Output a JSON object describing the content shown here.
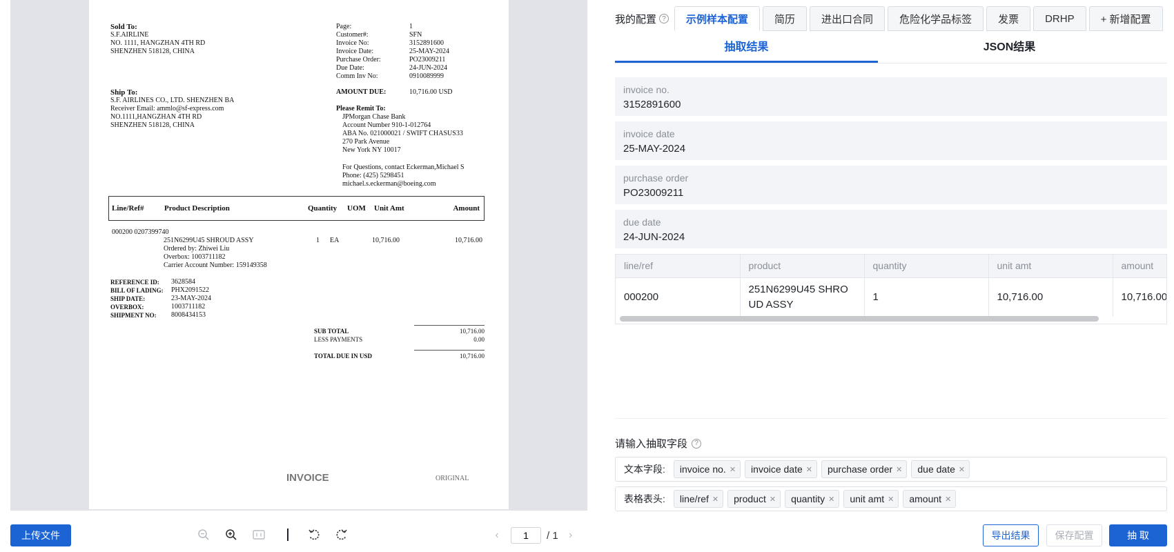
{
  "document": {
    "sold_to": {
      "title": "Sold To:",
      "lines": [
        "S.F.AIRLINE",
        "NO. 1111, HANGZHAN 4TH RD",
        "SHENZHEN  518128, CHINA"
      ]
    },
    "ship_to": {
      "title": "Ship To:",
      "lines": [
        "S.F. AIRLINES CO., LTD. SHENZHEN BA",
        "Receiver Email: ammlo@sf-express.com",
        "NO.1111,HANGZHAN 4TH RD",
        "SHENZHEN   518128, CHINA"
      ]
    },
    "meta": [
      {
        "k": "Page:",
        "v": "1"
      },
      {
        "k": "Customer#:",
        "v": "SFN"
      },
      {
        "k": "Invoice No:",
        "v": "3152891600"
      },
      {
        "k": "Invoice Date:",
        "v": "25-MAY-2024"
      },
      {
        "k": "Purchase Order:",
        "v": "PO23009211"
      },
      {
        "k": "Due Date:",
        "v": "24-JUN-2024"
      },
      {
        "k": "Comm Inv No:",
        "v": "0910089999"
      }
    ],
    "amount_due_label": "AMOUNT DUE:",
    "amount_due_value": "10,716.00  USD",
    "remit_title": "Please Remit To:",
    "remit_lines": [
      "JPMorgan Chase Bank",
      "Account Number 910-1-012764",
      "ABA No. 021000021 / SWIFT CHASUS33",
      "270 Park Avenue",
      "New York NY 10017"
    ],
    "contact_lines": [
      "For Questions, contact  Eckerman,Michael S",
      "Phone:  (425) 5298451",
      "michael.s.eckerman@boeing.com"
    ],
    "table_headers": {
      "line": "Line/Ref#",
      "desc": "Product Description",
      "qty": "Quantity",
      "uom": "UOM",
      "unit": "Unit Amt",
      "amount": "Amount"
    },
    "line_ref": "000200 0207399740",
    "item_desc": [
      "251N6299U45  SHROUD ASSY",
      "Ordered by:  Zhiwei Liu",
      "Overbox: 1003711182",
      "Carrier Account Number: 159149358"
    ],
    "item_qty": "1",
    "item_uom": "EA",
    "item_unit": "10,716.00",
    "item_amount": "10,716.00",
    "refs": [
      {
        "k": "REFERENCE ID:",
        "v": "3628584"
      },
      {
        "k": "BILL OF LADING:",
        "v": "PHX2091522"
      },
      {
        "k": "SHIP DATE:",
        "v": "23-MAY-2024"
      },
      {
        "k": "OVERBOX:",
        "v": "1003711182"
      },
      {
        "k": "SHIPMENT NO:",
        "v": "8008434153"
      }
    ],
    "subtotal_label": "SUB TOTAL",
    "subtotal_value": "10,716.00",
    "payments_label": "LESS PAYMENTS",
    "payments_value": "0.00",
    "total_label": "TOTAL DUE IN USD",
    "total_value": "10,716.00",
    "footer_left": "INVOICE",
    "footer_right": "ORIGINAL"
  },
  "viewer": {
    "upload_label": "上传文件",
    "page_current": "1",
    "page_total": "/ 1"
  },
  "panel": {
    "config_title": "我的配置",
    "config_tabs": [
      "示例样本配置",
      "简历",
      "进出口合同",
      "危险化学品标签",
      "发票",
      "DRHP",
      "+ 新增配置"
    ],
    "result_tabs": [
      "抽取结果",
      "JSON结果"
    ],
    "fields": [
      {
        "label": "invoice no.",
        "value": "3152891600"
      },
      {
        "label": "invoice date",
        "value": "25-MAY-2024"
      },
      {
        "label": "purchase order",
        "value": "PO23009211"
      },
      {
        "label": "due date",
        "value": "24-JUN-2024"
      }
    ],
    "table": {
      "headers": [
        "line/ref",
        "product",
        "quantity",
        "unit amt",
        "amount"
      ],
      "row": [
        "000200",
        "251N6299U45 SHROUD ASSY",
        "1",
        "10,716.00",
        "10,716.00"
      ]
    },
    "input_title": "请输入抽取字段",
    "text_fields_label": "文本字段:",
    "text_tags": [
      "invoice no.",
      "invoice date",
      "purchase order",
      "due date"
    ],
    "table_headers_label": "表格表头:",
    "table_tags": [
      "line/ref",
      "product",
      "quantity",
      "unit amt",
      "amount"
    ],
    "export_label": "导出结果",
    "save_label": "保存配置",
    "extract_label": "抽 取"
  }
}
